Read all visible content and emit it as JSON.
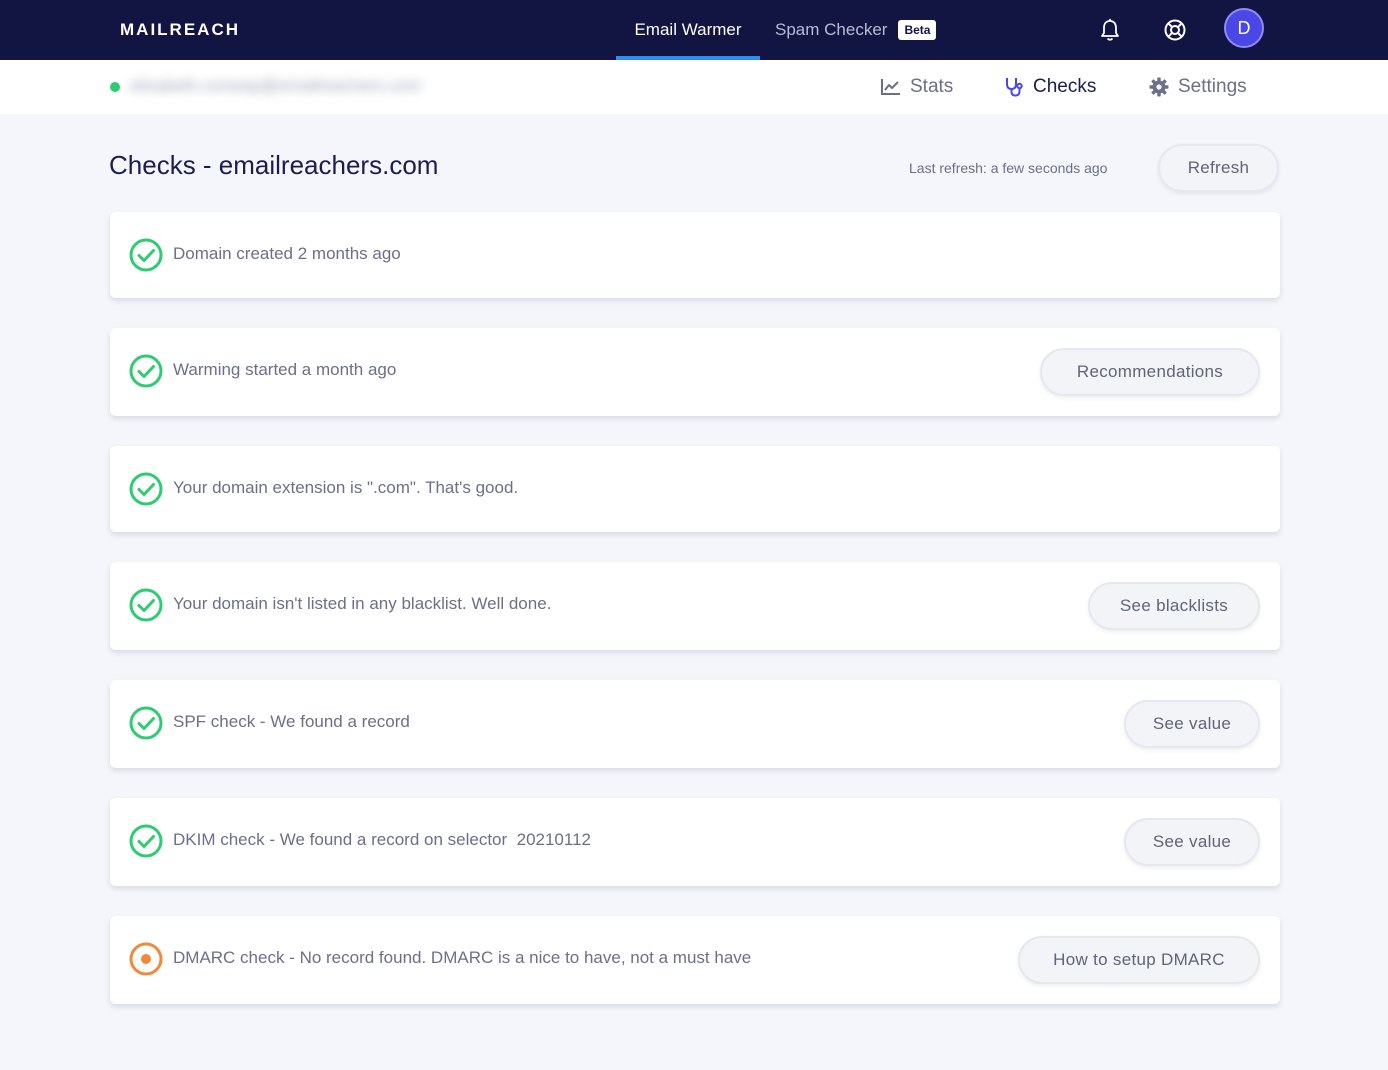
{
  "topnav": {
    "logo": "MAILREACH",
    "tabs": [
      {
        "label": "Email Warmer",
        "active": true
      },
      {
        "label": "Spam Checker",
        "active": false,
        "badge": "Beta"
      }
    ],
    "icons": [
      "bell-icon",
      "lifebuoy-icon"
    ],
    "avatar_initial": "D"
  },
  "subnav": {
    "email": "elizabeth.conway@emailreachers.com",
    "tabs": [
      {
        "label": "Stats",
        "icon": "chart-icon",
        "active": false
      },
      {
        "label": "Checks",
        "icon": "stethoscope-icon",
        "active": true
      },
      {
        "label": "Settings",
        "icon": "gear-icon",
        "active": false
      }
    ]
  },
  "page": {
    "title": "Checks - emailreachers.com",
    "last_refresh": "Last refresh: a few seconds ago",
    "refresh_label": "Refresh"
  },
  "checks": [
    {
      "text": "Domain created 2 months ago",
      "status": "ok",
      "button": ""
    },
    {
      "text": "Warming started a month ago",
      "status": "ok",
      "button": "Recommendations"
    },
    {
      "text": "Your domain extension is \".com\". That's good.",
      "status": "ok",
      "button": ""
    },
    {
      "text": "Your domain isn't listed in any blacklist. Well done.",
      "status": "ok",
      "button": "See blacklists"
    },
    {
      "text": "SPF check - We found a record",
      "status": "ok",
      "button": "See value"
    },
    {
      "text": "DKIM check - We found a record on selector  20210112",
      "status": "ok",
      "button": "See value"
    },
    {
      "text": "DMARC check - No record found. DMARC is a nice to have, not a must have",
      "status": "warning",
      "button": "How to setup DMARC"
    }
  ],
  "colors": {
    "nav_bg": "#121442",
    "accent": "#2f8cf0",
    "ok": "#2ecc71",
    "warning": "#f08a3a",
    "avatar": "#4b46e6"
  }
}
